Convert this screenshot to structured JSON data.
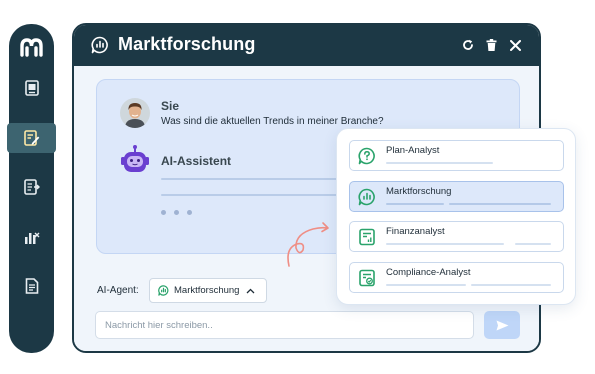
{
  "window": {
    "title": "Marktforschung",
    "buttons": [
      "refresh-icon",
      "trash-icon",
      "close-icon"
    ]
  },
  "sidebar": {
    "items": [
      "image-icon",
      "edit-document-icon",
      "forward-document-icon",
      "chart-icon",
      "file-icon"
    ],
    "active_index": 1
  },
  "chat": {
    "user_name": "Sie",
    "user_message": "Was sind die aktuellen Trends in meiner Branche?",
    "assistant_name": "AI-Assistent"
  },
  "composer": {
    "agent_label": "AI-Agent:",
    "agent_selected": "Marktforschung",
    "input_placeholder": "Nachricht hier schreiben.."
  },
  "agent_menu": {
    "items": [
      {
        "label": "Plan-Analyst",
        "icon": "question-bubble-icon"
      },
      {
        "label": "Marktforschung",
        "icon": "chat-chart-icon",
        "selected": true
      },
      {
        "label": "Finanzanalyst",
        "icon": "finance-report-icon"
      },
      {
        "label": "Compliance-Analyst",
        "icon": "compliance-check-icon"
      }
    ]
  },
  "colors": {
    "sidebar": "#1c3845",
    "accent": "#2aa36b",
    "bot": "#6a3fd0",
    "arrow": "#ef8e85"
  }
}
